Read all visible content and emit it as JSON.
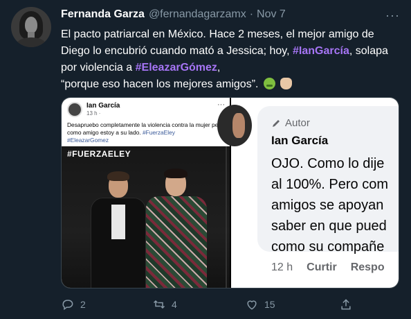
{
  "tweet": {
    "author_name": "Fernanda Garza",
    "handle": "@fernandagarzamx",
    "separator": "·",
    "date": "Nov 7",
    "more_label": "···",
    "text_1": "El pacto patriarcal en México. Hace 2 meses, el mejor amigo de Diego lo encubrió cuando mató a Jessica; hoy, ",
    "hashtag_1": "#IanGarcía",
    "text_2": ", solapa por violencia a ",
    "hashtag_2": "#EleazarGómez",
    "text_3": ",",
    "text_4": "“porque eso hacen los mejores amigos”.",
    "emoji_1": "nauseated-face",
    "emoji_2": "pinching-hand"
  },
  "media_left": {
    "fb_name": "Ian García",
    "fb_time": "13 h ·",
    "fb_dots": "···",
    "fb_text": "Desapruebo completamente la  violencia contra la mujer pero como amigo estoy a su lado. ",
    "fb_tag_1": "#FuerzaEley",
    "fb_tag_2": "#EleazarGomez",
    "photo_tag": "#FUERZAELEY"
  },
  "media_right": {
    "autor_label": "Autor",
    "name": "Ian García",
    "line_1": "OJO. Como lo dije",
    "line_2": "al 100%. Pero com",
    "line_3": "amigos se apoyan",
    "line_4": "saber en que pued",
    "line_5": "como su compañe",
    "time": "12 h",
    "like_action": "Curtir",
    "reply_action": "Respo"
  },
  "actions": {
    "reply_count": "2",
    "retweet_count": "4",
    "like_count": "15"
  },
  "colors": {
    "background": "#15202b",
    "muted": "#8899a6",
    "hashtag": "#a675f5"
  }
}
